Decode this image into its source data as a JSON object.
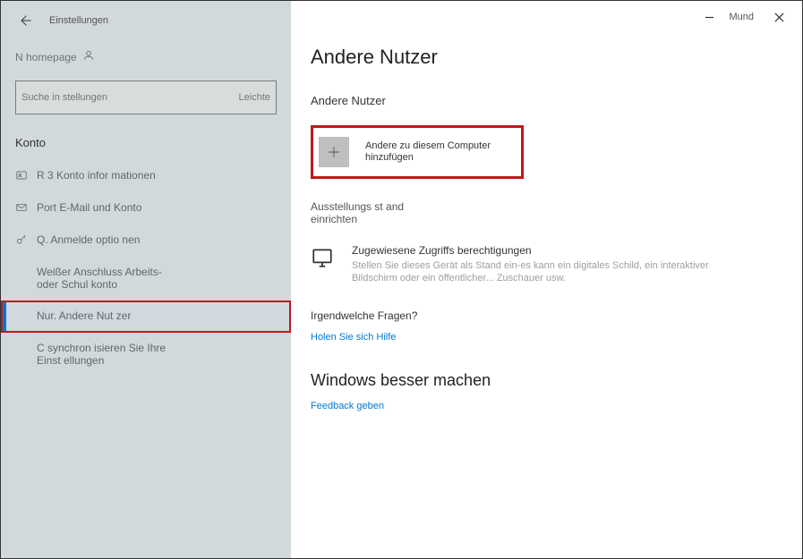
{
  "window": {
    "title_right": "Mund",
    "settings_label": "Einstellungen"
  },
  "sidebar": {
    "user_label": "N homepage",
    "search_placeholder": "Suche in stellungen",
    "search_hint": "Leichte",
    "section": "Konto",
    "items": [
      {
        "label": "R 3 Konto infor mationen"
      },
      {
        "label": "Port E-Mail und Konto"
      },
      {
        "label": "Q. Anmelde optio nen"
      },
      {
        "label": "Weißer Anschluss Arbeits-oder Schul konto"
      },
      {
        "label": "Nur. Andere Nut zer"
      },
      {
        "label": "C synchron isieren Sie Ihre Einst ellungen"
      }
    ]
  },
  "main": {
    "page_title": "Andere Nutzer",
    "subhead": "Andere Nutzer",
    "add_user": "Andere zu diesem Computer hinzufügen",
    "kiosk_head": "Ausstellungs st and einrichten",
    "kiosk_title": "Zugewiesene Zugriffs berechtigungen",
    "kiosk_desc": "Stellen Sie dieses Gerät als Stand ein-es kann ein digitales Schild, ein interaktiver Bildschirm oder ein öffentlicher... Zuschauer usw.",
    "question_head": "Irgendwelche Fragen?",
    "help_link": "Holen Sie sich Hilfe",
    "better_head": "Windows besser machen",
    "feedback_link": "Feedback geben"
  }
}
